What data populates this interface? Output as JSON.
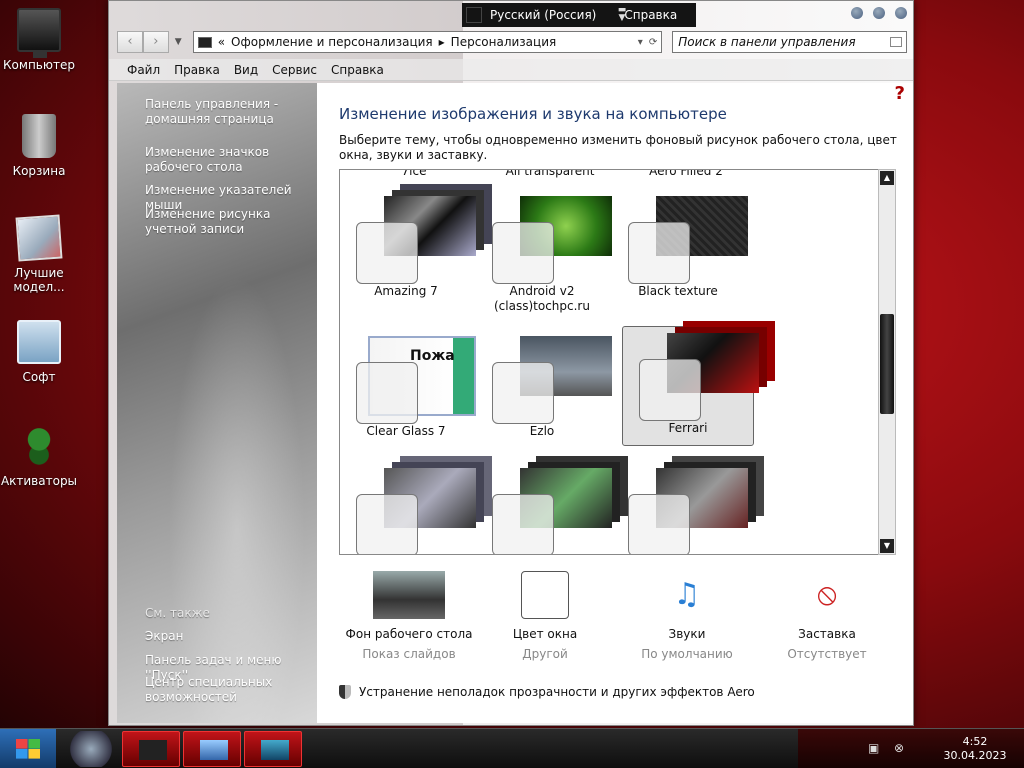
{
  "desktop": {
    "icons": [
      {
        "label": "Компьютер"
      },
      {
        "label": "Корзина"
      },
      {
        "label": "Лучшие модел..."
      },
      {
        "label": "Софт"
      },
      {
        "label": "Активаторы"
      }
    ]
  },
  "language_bar": {
    "language": "Русский (Россия)",
    "help": "Справка"
  },
  "navigation": {
    "back_glyph": "‹",
    "forward_glyph": "›",
    "breadcrumb_prefix": "«",
    "breadcrumb": [
      "Оформление и персонализация",
      "Персонализация"
    ],
    "breadcrumb_separator": "▸",
    "search_placeholder": "Поиск в панели управления"
  },
  "menu": [
    "Файл",
    "Правка",
    "Вид",
    "Сервис",
    "Справка"
  ],
  "sidebar": {
    "links": [
      "Панель управления - домашняя страница",
      "Изменение значков рабочего стола",
      "Изменение указателей мыши",
      "Изменение рисунка учетной записи"
    ],
    "see_also_heading": "См. также",
    "see_also": [
      "Экран",
      "Панель задач и меню ''Пуск''",
      "Центр специальных возможностей"
    ]
  },
  "content": {
    "title": "Изменение изображения и звука на компьютере",
    "help_glyph": "?",
    "description": "Выберите тему, чтобы одновременно изменить фоновый рисунок рабочего стола, цвет окна, звуки и заставку.",
    "partial_top_labels": [
      "7ice",
      "All transparent",
      "Aero Filled 2"
    ],
    "themes": [
      {
        "label": "Amazing 7"
      },
      {
        "label": "Android v2 (class)tochpc.ru"
      },
      {
        "label": "Black texture"
      },
      {
        "label": "Clear Glass 7",
        "preview_text": "Пожа"
      },
      {
        "label": "Ezlo"
      },
      {
        "label": "Ferrari",
        "selected": true
      },
      {
        "label": ""
      },
      {
        "label": ""
      },
      {
        "label": ""
      }
    ],
    "options": [
      {
        "label": "Фон рабочего стола",
        "sub": "Показ слайдов",
        "icon": "wallpaper-icon"
      },
      {
        "label": "Цвет окна",
        "sub": "Другой",
        "icon": "window-color-icon"
      },
      {
        "label": "Звуки",
        "sub": "По умолчанию",
        "icon": "sounds-icon"
      },
      {
        "label": "Заставка",
        "sub": "Отсутствует",
        "icon": "screensaver-icon"
      }
    ],
    "aero_link": "Устранение неполадок прозрачности и других эффектов Aero"
  },
  "taskbar": {
    "time": "4:52",
    "date": "30.04.2023"
  },
  "colors": {
    "desktop_red": "#c0141a",
    "title_blue": "#1e3a6e"
  }
}
